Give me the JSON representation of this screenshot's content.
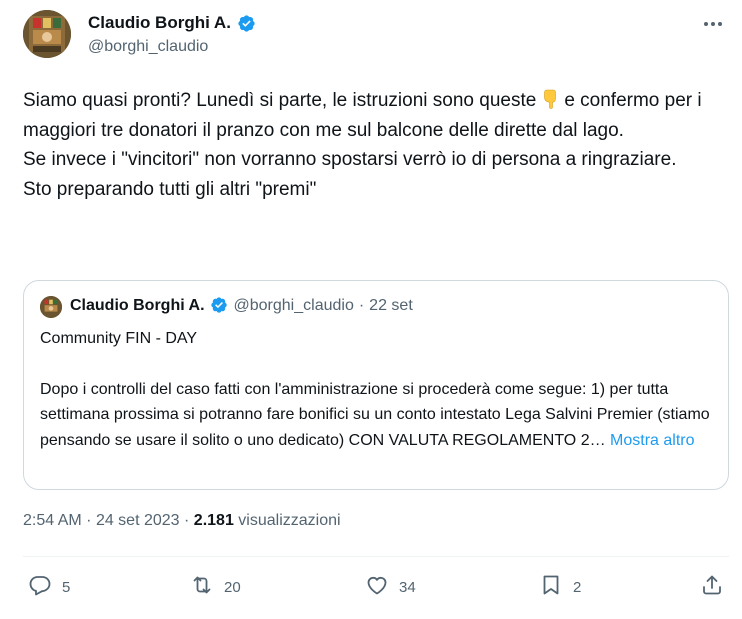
{
  "author": {
    "display_name": "Claudio Borghi A.",
    "handle": "@borghi_claudio"
  },
  "tweet": {
    "lines": [
      "Siamo quasi pronti? Lunedì si parte, le istruzioni sono queste",
      "e confermo per i maggiori tre donatori il pranzo con me sul balcone delle dirette dal lago.",
      "Se invece i \"vincitori\" non vorranno spostarsi verrò io di persona a ringraziare.",
      "Sto preparando tutti gli altri \"premi\""
    ],
    "emoji": "backhand-index-pointing-down"
  },
  "quote": {
    "display_name": "Claudio Borghi A.",
    "handle": "@borghi_claudio",
    "separator": "·",
    "date": "22 set",
    "title": "Community FIN - DAY",
    "body": "Dopo i controlli del caso fatti con l'amministrazione si procederà come segue: 1) per tutta settimana prossima si potranno fare bonifici su un conto intestato Lega Salvini Premier (stiamo pensando se usare il solito o uno dedicato) CON VALUTA REGOLAMENTO 2…",
    "show_more": "Mostra altro"
  },
  "meta": {
    "time": "2:54 AM",
    "separator": "·",
    "date": "24 set 2023",
    "views_count": "2.181",
    "views_label": "visualizzazioni"
  },
  "actions": {
    "replies": "5",
    "reposts": "20",
    "likes": "34",
    "bookmarks": "2"
  },
  "colors": {
    "accent": "#1d9bf0",
    "text": "#0f1419",
    "secondary": "#536471",
    "border": "#cfd9de"
  },
  "icons": [
    "verified-badge-icon",
    "more-icon",
    "reply-icon",
    "repost-icon",
    "like-icon",
    "bookmark-icon",
    "share-icon"
  ]
}
